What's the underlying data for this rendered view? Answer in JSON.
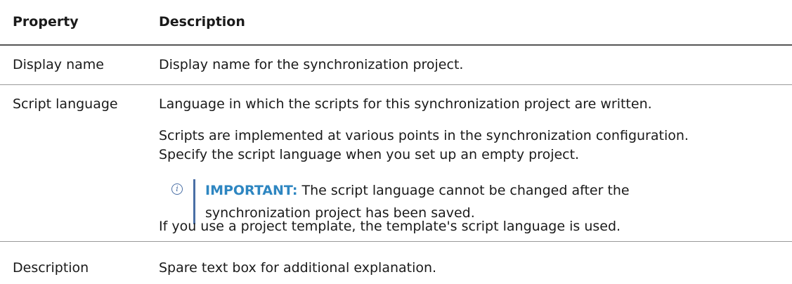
{
  "table": {
    "headers": [
      "Property",
      "Description"
    ],
    "rows": [
      {
        "property": "Display name",
        "description": "Display name for the synchronization project."
      },
      {
        "property": "Script language",
        "description_p1": "Language in which the scripts for this synchronization project are written.",
        "description_p2_line1": "Scripts are implemented at various points in the synchronization configuration.",
        "description_p2_line2": "Specify the script language when you set up an empty project.",
        "note": {
          "label": "IMPORTANT:",
          "line1": " The script language cannot be changed after the",
          "line2": "synchronization project has been saved."
        },
        "description_p3": "If you use a project template, the template's script language is used."
      },
      {
        "property": "Description",
        "description": "Spare text box for additional explanation."
      }
    ]
  },
  "icons": {
    "note_icon": "info-icon"
  },
  "colors": {
    "accent": "#2e86c1",
    "note_bar": "#4a6fa5"
  }
}
